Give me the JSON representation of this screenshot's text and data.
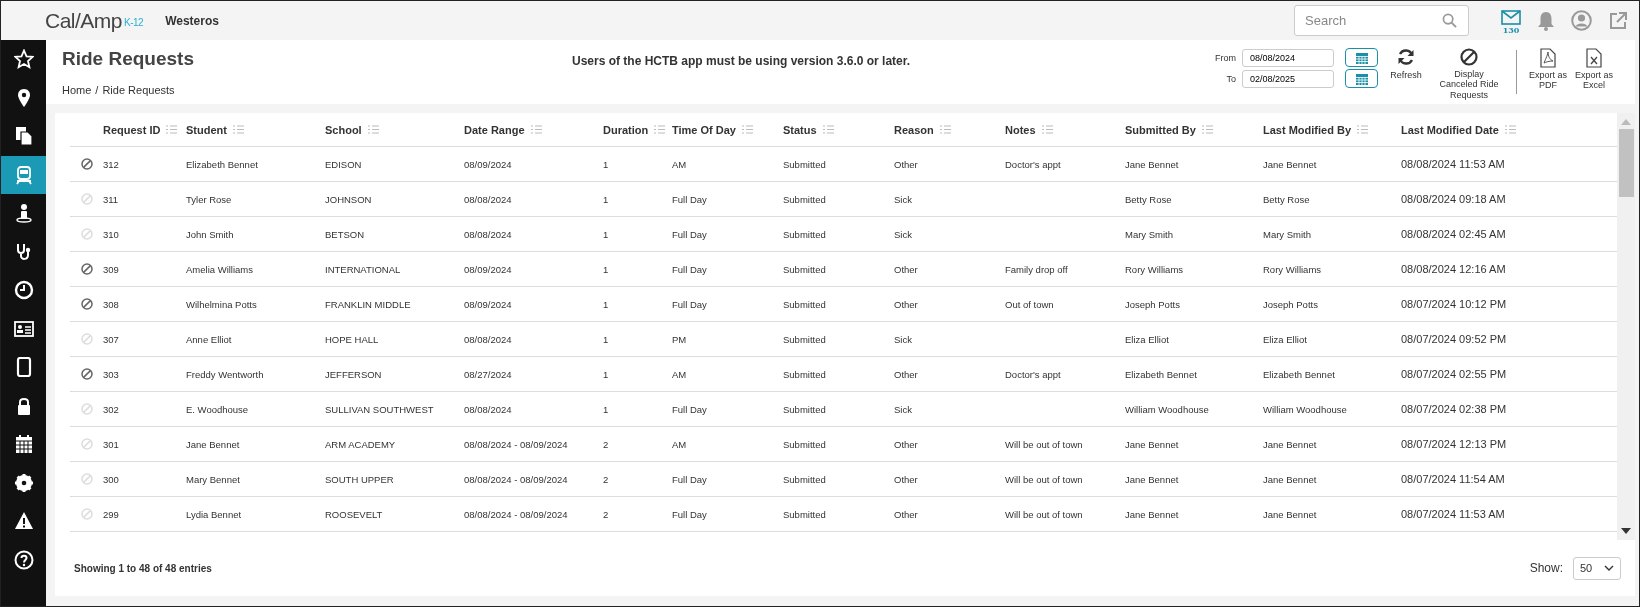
{
  "header": {
    "logo": "Cal/Amp",
    "logo_suffix": "K-12",
    "organization": "Westeros",
    "search": {
      "placeholder": "Search"
    },
    "mail_count": "130"
  },
  "sidebar": {
    "items": [
      {
        "selected": false
      },
      {
        "selected": false
      },
      {
        "selected": false
      },
      {
        "selected": true
      },
      {
        "selected": false
      },
      {
        "selected": false
      },
      {
        "selected": false
      },
      {
        "selected": false
      },
      {
        "selected": false
      },
      {
        "selected": false
      },
      {
        "selected": false
      },
      {
        "selected": false
      },
      {
        "selected": false
      },
      {
        "selected": false
      }
    ]
  },
  "page": {
    "title": "Ride Requests",
    "breadcrumb": [
      "Home",
      "Ride Requests"
    ],
    "breadcrumb_separator": "/",
    "notice": "Users of the HCTB app must be using version 3.6.0 or later.",
    "from": {
      "label": "From",
      "value": "08/08/2024"
    },
    "to": {
      "label": "To",
      "value": "02/08/2025"
    },
    "actions": [
      "Refresh",
      "Display Canceled Ride Requests"
    ],
    "exports": [
      "Export as PDF",
      "Export as Excel"
    ]
  },
  "table": {
    "columns": [
      "Request ID",
      "Student",
      "School",
      "Date Range",
      "Duration",
      "Time Of Day",
      "Status",
      "Reason",
      "Notes",
      "Submitted By",
      "Last Modified By",
      "Last Modified Date"
    ],
    "rows": [
      {
        "cancelable": true,
        "cells": [
          "312",
          "Elizabeth Bennet",
          "EDISON",
          "08/09/2024",
          "1",
          "AM",
          "Submitted",
          "Other",
          "Doctor's appt",
          "Jane Bennet",
          "Jane Bennet",
          "08/08/2024 11:53 AM"
        ]
      },
      {
        "cancelable": false,
        "cells": [
          "311",
          "Tyler Rose",
          "JOHNSON",
          "08/08/2024",
          "1",
          "Full Day",
          "Submitted",
          "Sick",
          "",
          "Betty Rose",
          "Betty Rose",
          "08/08/2024 09:18 AM"
        ]
      },
      {
        "cancelable": false,
        "cells": [
          "310",
          "John Smith",
          "BETSON",
          "08/08/2024",
          "1",
          "Full Day",
          "Submitted",
          "Sick",
          "",
          "Mary Smith",
          "Mary Smith",
          "08/08/2024 02:45 AM"
        ]
      },
      {
        "cancelable": true,
        "cells": [
          "309",
          "Amelia Williams",
          "INTERNATIONAL",
          "08/09/2024",
          "1",
          "Full Day",
          "Submitted",
          "Other",
          "Family drop off",
          "Rory Williams",
          "Rory Williams",
          "08/08/2024 12:16 AM"
        ]
      },
      {
        "cancelable": true,
        "cells": [
          "308",
          "Wilhelmina Potts",
          "FRANKLIN MIDDLE",
          "08/09/2024",
          "1",
          "Full Day",
          "Submitted",
          "Other",
          "Out of town",
          "Joseph Potts",
          "Joseph Potts",
          "08/07/2024 10:12 PM"
        ]
      },
      {
        "cancelable": false,
        "cells": [
          "307",
          "Anne Elliot",
          "HOPE HALL",
          "08/08/2024",
          "1",
          "PM",
          "Submitted",
          "Sick",
          "",
          "Eliza Elliot",
          "Eliza Elliot",
          "08/07/2024 09:52 PM"
        ]
      },
      {
        "cancelable": true,
        "cells": [
          "303",
          "Freddy Wentworth",
          "JEFFERSON",
          "08/27/2024",
          "1",
          "AM",
          "Submitted",
          "Other",
          "Doctor's appt",
          "Elizabeth Bennet",
          "Elizabeth Bennet",
          "08/07/2024 02:55 PM"
        ]
      },
      {
        "cancelable": false,
        "cells": [
          "302",
          "E. Woodhouse",
          "SULLIVAN SOUTHWEST",
          "08/08/2024",
          "1",
          "Full Day",
          "Submitted",
          "Sick",
          "",
          "William Woodhouse",
          "William Woodhouse",
          "08/07/2024 02:38 PM"
        ]
      },
      {
        "cancelable": false,
        "cells": [
          "301",
          "Jane Bennet",
          "ARM ACADEMY",
          "08/08/2024 - 08/09/2024",
          "2",
          "AM",
          "Submitted",
          "Other",
          "Will be out of town",
          "Jane Bennet",
          "Jane Bennet",
          "08/07/2024 12:13 PM"
        ]
      },
      {
        "cancelable": false,
        "cells": [
          "300",
          "Mary Bennet",
          "SOUTH UPPER",
          "08/08/2024 - 08/09/2024",
          "2",
          "Full Day",
          "Submitted",
          "Other",
          "Will be out of town",
          "Jane Bennet",
          "Jane Bennet",
          "08/07/2024 11:54 AM"
        ]
      },
      {
        "cancelable": false,
        "cells": [
          "299",
          "Lydia Bennet",
          "ROOSEVELT",
          "08/08/2024 - 08/09/2024",
          "2",
          "Full Day",
          "Submitted",
          "Other",
          "Will be out of town",
          "Jane Bennet",
          "Jane Bennet",
          "08/07/2024 11:53 AM"
        ]
      }
    ]
  },
  "footer": {
    "summary": "Showing 1 to 48 of 48 entries",
    "show_label": "Show:",
    "page_size": "50"
  }
}
